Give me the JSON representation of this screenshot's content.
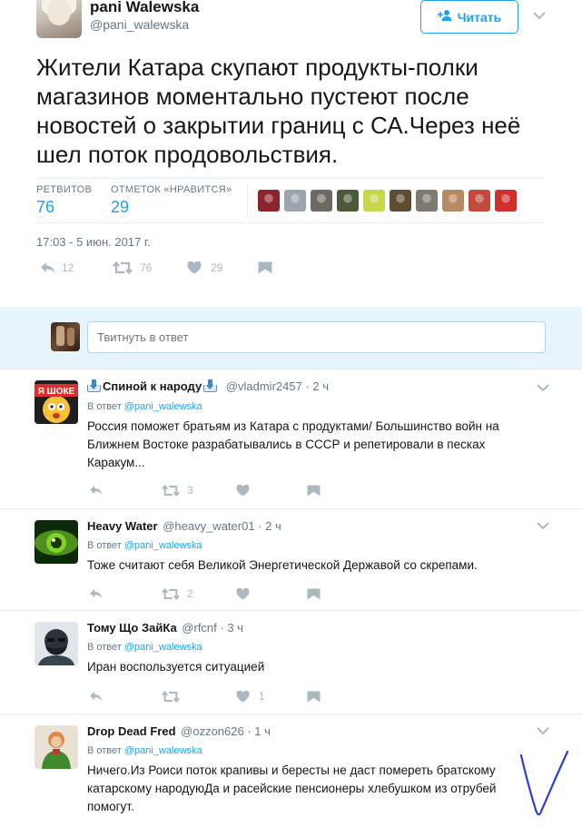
{
  "main_tweet": {
    "author_name": "pani Walewska",
    "author_handle": "@pani_walewska",
    "follow_label": "Читать",
    "text": "Жители Катара скупают продукты-полки магазинов моментально пустеют после новостей о закрытии границ с СА.Через неё шел поток продовольствия.",
    "retweets_label": "РЕТВИТОВ",
    "retweets_count": "76",
    "likes_label": "ОТМЕТОК «НРАВИТСЯ»",
    "likes_count": "29",
    "timestamp": "17:03 - 5 июн. 2017 г.",
    "actions": {
      "reply_count": "12",
      "retweet_count": "76",
      "like_count": "29"
    },
    "likers_colors": [
      "#8a2530",
      "#9aa5ae",
      "#6d6a62",
      "#4b5a3a",
      "#c9d64a",
      "#5e4d32",
      "#7d7a70",
      "#b78a63",
      "#c24a3b",
      "#d0302c"
    ]
  },
  "reply_box": {
    "placeholder": "Твитнуть в ответ"
  },
  "replies": [
    {
      "name": "Спиной к народу",
      "handle": "@vladmir2457",
      "time": "2 ч",
      "in_reply_prefix": "В ответ",
      "in_reply_to": "@pani_walewska",
      "text": "Россия поможет братьям из Катара с продуктами/ Большинство войн на Ближнем Востоке разрабатывались в СССР и репетировали в песках Каракум...",
      "retweets": "3",
      "likes": ""
    },
    {
      "name": "Heavy Water",
      "handle": "@heavy_water01",
      "time": "2 ч",
      "in_reply_prefix": "В ответ",
      "in_reply_to": "@pani_walewska",
      "text": "Тоже считают себя Великой Энергетической Державой со скрепами.",
      "retweets": "2",
      "likes": ""
    },
    {
      "name": "Тому Що ЗайКа",
      "handle": "@rfcnf",
      "time": "3 ч",
      "in_reply_prefix": "В ответ",
      "in_reply_to": "@pani_walewska",
      "text": "Иран воспользуется ситуацией",
      "retweets": "",
      "likes": "1"
    },
    {
      "name": "Drop Dead Fred",
      "handle": "@ozzon626",
      "time": "1 ч",
      "in_reply_prefix": "В ответ",
      "in_reply_to": "@pani_walewska",
      "text": "Ничего.Из Роиси поток крапивы и бересты не даст помереть братскому катарскому народуюДа и расейские пенсионеры хлебушком из отрубей помогут."
    }
  ],
  "avatar_badge_text": "Я ШОКЕ",
  "colors": {
    "accent": "#1da1f2",
    "muted": "#657786",
    "icon": "#aab8c2",
    "reply_bg": "#e8f4fb",
    "annotation": "#2e3fd1"
  }
}
